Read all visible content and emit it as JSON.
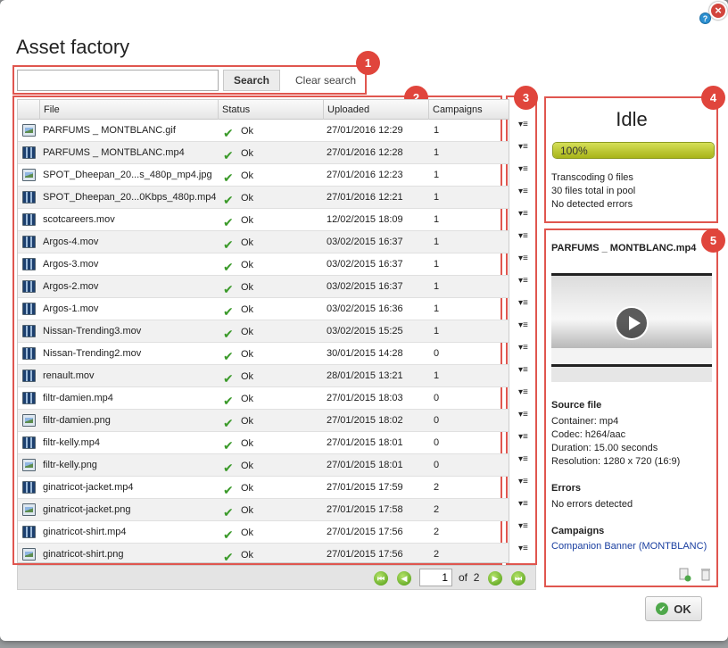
{
  "dialog": {
    "title": "Asset factory",
    "close_glyph": "×",
    "help_glyph": "?"
  },
  "search": {
    "value": "",
    "placeholder": "",
    "search_label": "Search",
    "clear_label": "Clear search"
  },
  "table": {
    "columns": [
      "File",
      "Status",
      "Uploaded",
      "Campaigns"
    ],
    "rows": [
      {
        "icon": "image",
        "file": "PARFUMS _ MONTBLANC.gif",
        "status": "Ok",
        "uploaded": "27/01/2016 12:29",
        "campaigns": "1"
      },
      {
        "icon": "video",
        "file": "PARFUMS _ MONTBLANC.mp4",
        "status": "Ok",
        "uploaded": "27/01/2016 12:28",
        "campaigns": "1"
      },
      {
        "icon": "image",
        "file": "SPOT_Dheepan_20...s_480p_mp4.jpg",
        "status": "Ok",
        "uploaded": "27/01/2016 12:23",
        "campaigns": "1"
      },
      {
        "icon": "video",
        "file": "SPOT_Dheepan_20...0Kbps_480p.mp4",
        "status": "Ok",
        "uploaded": "27/01/2016 12:21",
        "campaigns": "1"
      },
      {
        "icon": "video",
        "file": "scotcareers.mov",
        "status": "Ok",
        "uploaded": "12/02/2015 18:09",
        "campaigns": "1"
      },
      {
        "icon": "video",
        "file": "Argos-4.mov",
        "status": "Ok",
        "uploaded": "03/02/2015 16:37",
        "campaigns": "1"
      },
      {
        "icon": "video",
        "file": "Argos-3.mov",
        "status": "Ok",
        "uploaded": "03/02/2015 16:37",
        "campaigns": "1"
      },
      {
        "icon": "video",
        "file": "Argos-2.mov",
        "status": "Ok",
        "uploaded": "03/02/2015 16:37",
        "campaigns": "1"
      },
      {
        "icon": "video",
        "file": "Argos-1.mov",
        "status": "Ok",
        "uploaded": "03/02/2015 16:36",
        "campaigns": "1"
      },
      {
        "icon": "video",
        "file": "Nissan-Trending3.mov",
        "status": "Ok",
        "uploaded": "03/02/2015 15:25",
        "campaigns": "1"
      },
      {
        "icon": "video",
        "file": "Nissan-Trending2.mov",
        "status": "Ok",
        "uploaded": "30/01/2015 14:28",
        "campaigns": "0"
      },
      {
        "icon": "video",
        "file": "renault.mov",
        "status": "Ok",
        "uploaded": "28/01/2015 13:21",
        "campaigns": "1"
      },
      {
        "icon": "video",
        "file": "filtr-damien.mp4",
        "status": "Ok",
        "uploaded": "27/01/2015 18:03",
        "campaigns": "0"
      },
      {
        "icon": "image",
        "file": "filtr-damien.png",
        "status": "Ok",
        "uploaded": "27/01/2015 18:02",
        "campaigns": "0"
      },
      {
        "icon": "video",
        "file": "filtr-kelly.mp4",
        "status": "Ok",
        "uploaded": "27/01/2015 18:01",
        "campaigns": "0"
      },
      {
        "icon": "image",
        "file": "filtr-kelly.png",
        "status": "Ok",
        "uploaded": "27/01/2015 18:01",
        "campaigns": "0"
      },
      {
        "icon": "video",
        "file": "ginatricot-jacket.mp4",
        "status": "Ok",
        "uploaded": "27/01/2015 17:59",
        "campaigns": "2"
      },
      {
        "icon": "image",
        "file": "ginatricot-jacket.png",
        "status": "Ok",
        "uploaded": "27/01/2015 17:58",
        "campaigns": "2"
      },
      {
        "icon": "video",
        "file": "ginatricot-shirt.mp4",
        "status": "Ok",
        "uploaded": "27/01/2015 17:56",
        "campaigns": "2"
      },
      {
        "icon": "image",
        "file": "ginatricot-shirt.png",
        "status": "Ok",
        "uploaded": "27/01/2015 17:56",
        "campaigns": "2"
      }
    ]
  },
  "pager": {
    "page": "1",
    "of_label": "of",
    "total_pages": "2"
  },
  "status": {
    "state": "Idle",
    "progress_label": "100%",
    "progress_fraction": 1.0,
    "lines": [
      "Transcoding 0 files",
      "30 files total in pool",
      "No detected errors"
    ]
  },
  "details": {
    "filename": "PARFUMS _ MONTBLANC.mp4",
    "source_heading": "Source file",
    "source_lines": [
      "Container: mp4",
      "Codec: h264/aac",
      "Duration: 15.00 seconds",
      "Resolution: 1280 x 720 (16:9)"
    ],
    "errors_heading": "Errors",
    "errors_text": "No errors detected",
    "campaigns_heading": "Campaigns",
    "campaign_link": "Companion Banner (MONTBLANC)"
  },
  "annotations": [
    "1",
    "2",
    "3",
    "4",
    "5"
  ],
  "ok_label": "OK",
  "colors": {
    "annotation": "#e0453c",
    "progress": "#b5c21e",
    "ok_check": "#3b9a2a",
    "link": "#1a3fa0"
  }
}
